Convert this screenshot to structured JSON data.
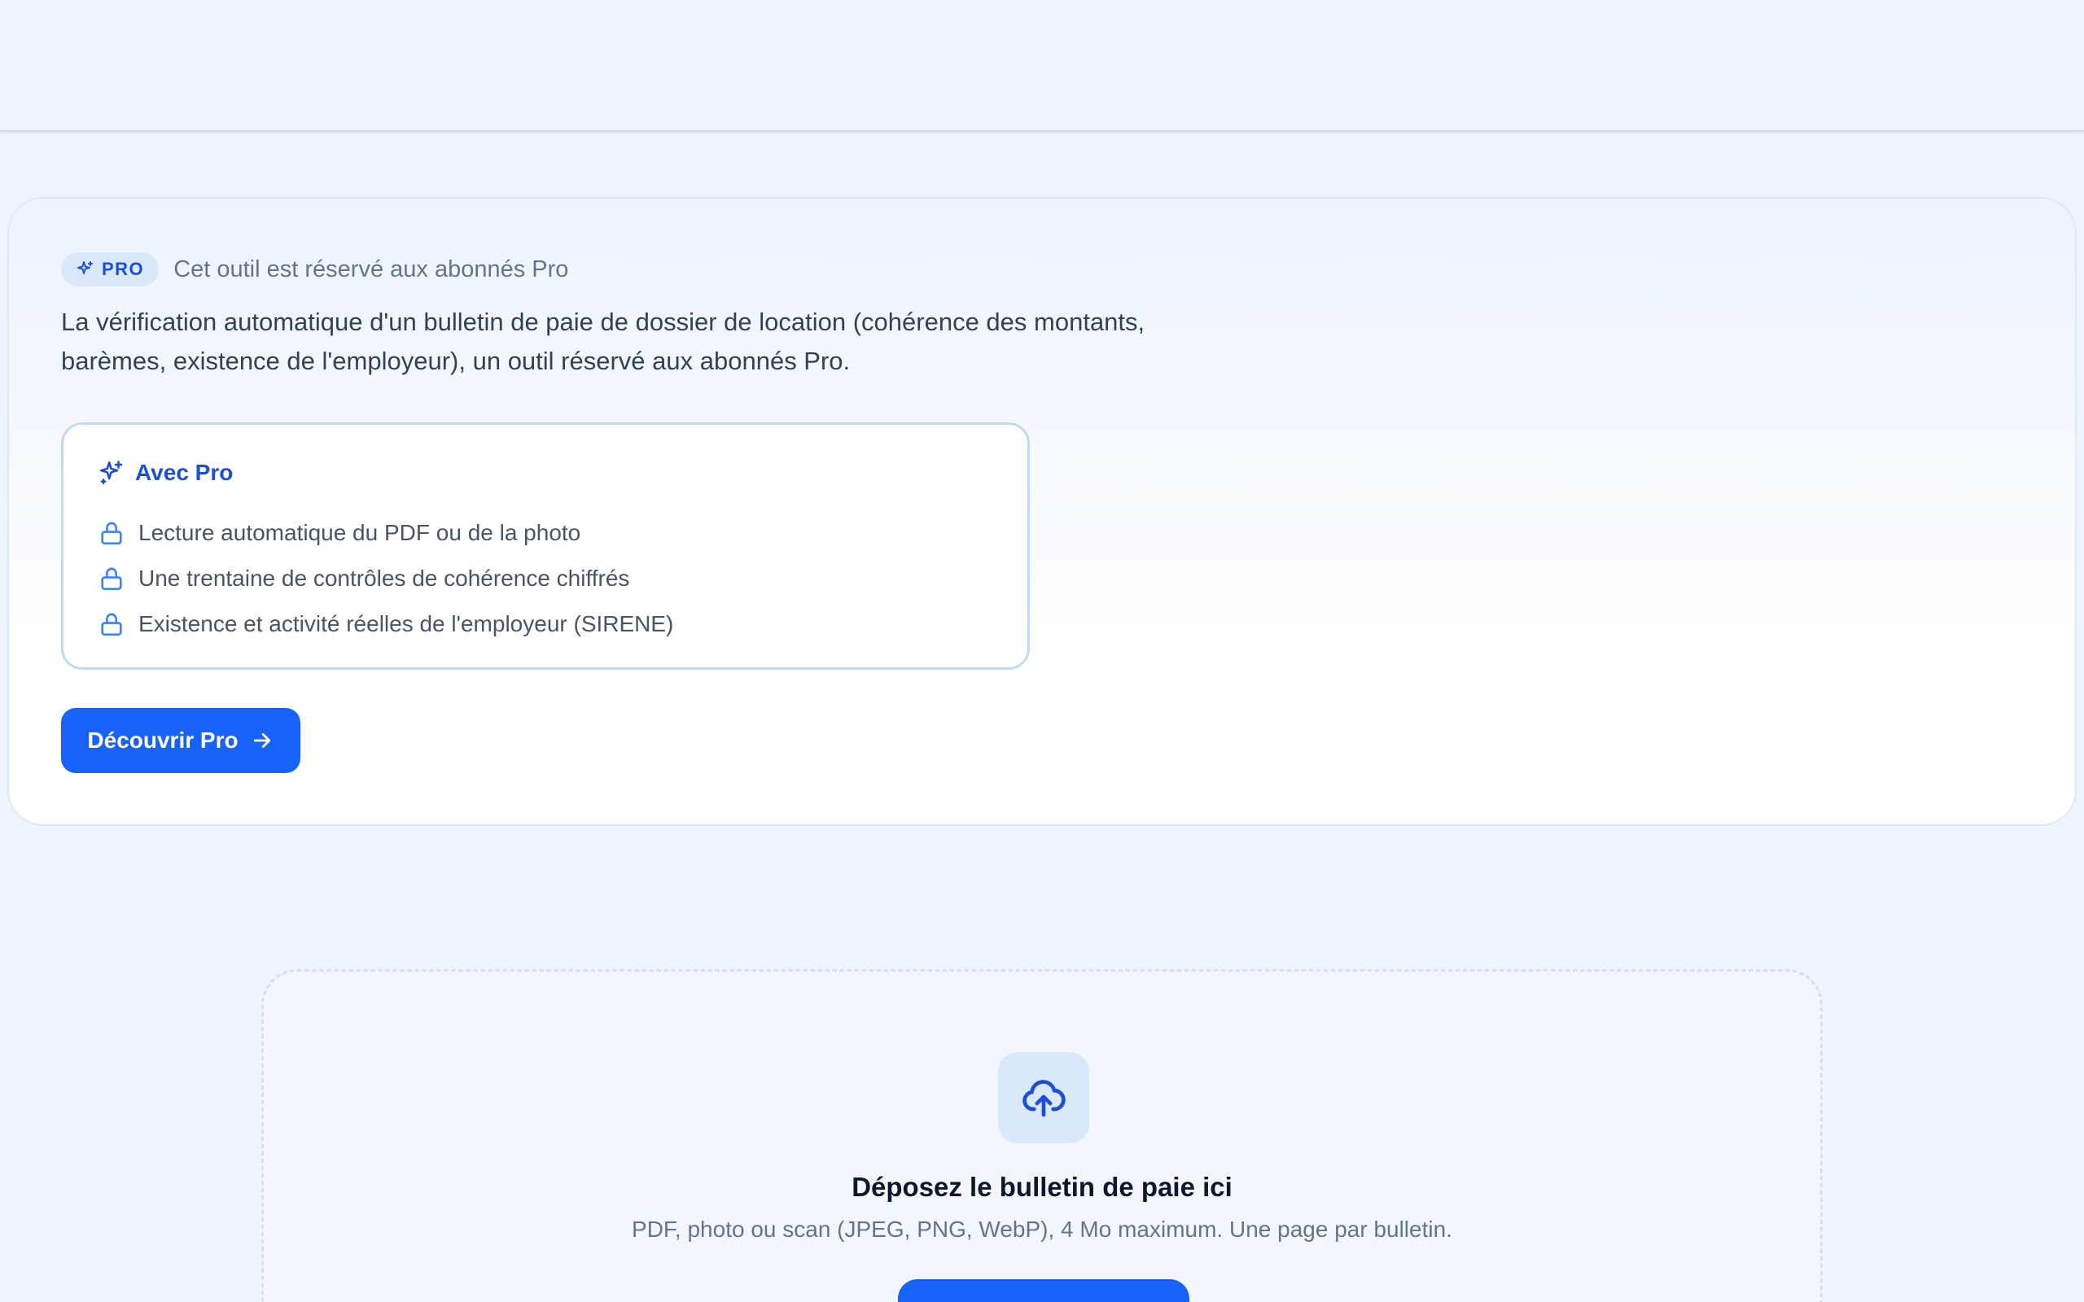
{
  "pro_gate": {
    "badge": "PRO",
    "note": "Cet outil est réservé aux abonnés Pro",
    "description": "La vérification automatique d'un bulletin de paie de dossier de location (cohérence des montants, barèmes, existence de l'employeur), un outil réservé aux abonnés Pro.",
    "features_title": "Avec Pro",
    "features": [
      "Lecture automatique du PDF ou de la photo",
      "Une trentaine de contrôles de cohérence chiffrés",
      "Existence et activité réelles de l'employeur (SIRENE)"
    ],
    "cta_label": "Découvrir Pro"
  },
  "dropzone": {
    "title": "Déposez le bulletin de paie ici",
    "subtitle": "PDF, photo ou scan (JPEG, PNG, WebP), 4 Mo maximum. Une page par bulletin.",
    "button_label": ""
  },
  "icons": {
    "badge": "sparkles-icon",
    "features_title": "sparkles-icon",
    "feature": "lock-icon",
    "cta": "arrow-right-icon",
    "upload": "cloud-upload-icon"
  },
  "colors": {
    "accent": "#1762f7",
    "accent_text": "#1d4ed8",
    "accent_soft": "#dbe8fc"
  }
}
